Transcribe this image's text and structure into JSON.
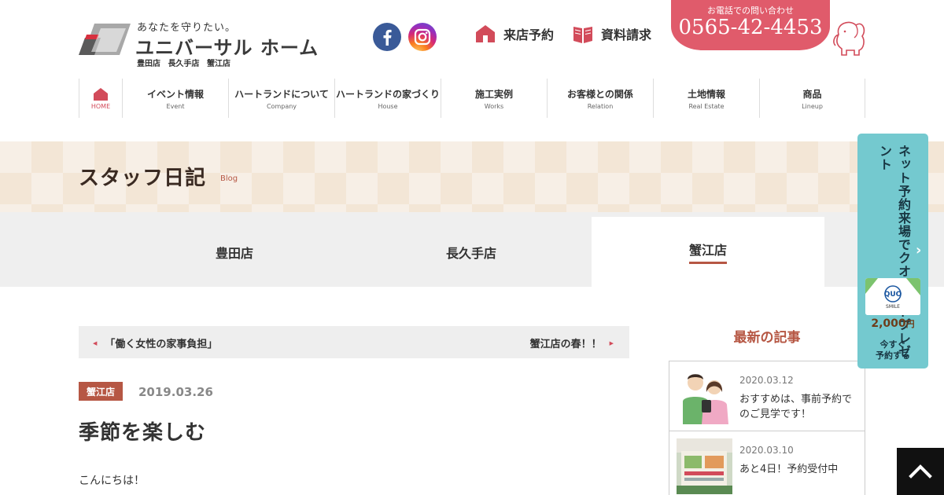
{
  "header": {
    "tagline": "あなたを守りたい。",
    "brand": "ユニバーサル ホーム",
    "branches_line": "豊田店 長久手店 蟹江店",
    "visit_label": "来店予約",
    "docs_label": "資料請求",
    "tel_label": "お電話での問い合わせ",
    "tel_number": "0565-42-4453"
  },
  "nav": {
    "home_label": "HOME",
    "items": [
      {
        "label": "イベント情報",
        "sub": "Event"
      },
      {
        "label": "ハートランドについて",
        "sub": "Company"
      },
      {
        "label": "ハートランドの家づくり",
        "sub": "House"
      },
      {
        "label": "施工実例",
        "sub": "Works"
      },
      {
        "label": "お客様との関係",
        "sub": "Relation"
      },
      {
        "label": "土地情報",
        "sub": "Real Estate"
      },
      {
        "label": "商品",
        "sub": "Lineup"
      }
    ]
  },
  "banner": {
    "title": "スタッフ日記",
    "sub": "Blog"
  },
  "tabs": [
    "豊田店",
    "長久手店",
    "蟹江店"
  ],
  "post": {
    "prev": "「働く女性の家事負担」",
    "next": "蟹江店の春！！",
    "category": "蟹江店",
    "date": "2019.03.26",
    "title": "季節を楽しむ",
    "body_first": "こんにちは！"
  },
  "sidebar": {
    "heading": "最新の記事",
    "items": [
      {
        "date": "2020.03.12",
        "title": "おすすめは、事前予約でのご見学です！"
      },
      {
        "date": "2020.03.10",
        "title": "あと4日！予約受付中"
      }
    ]
  },
  "quo": {
    "vertical": "ネット予約来場でクオカードプレゼント",
    "card_brand": "QUO",
    "card_sub": "SMILE",
    "price": "2,000",
    "yen": "円",
    "cta_line1": "今すぐ",
    "cta_line2": "予約する"
  },
  "colors": {
    "accent": "#b65744",
    "tel": "#e05b6b",
    "quo": "#74c9cf",
    "nav_home": "#d24b5a"
  },
  "icons": [
    "facebook-icon",
    "instagram-icon",
    "house-icon",
    "book-icon",
    "elephant-icon",
    "home-icon",
    "arrow-up-icon"
  ]
}
